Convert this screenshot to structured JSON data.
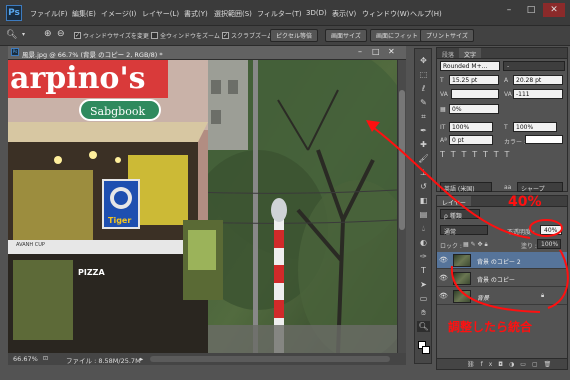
{
  "app": {
    "logo": "Ps"
  },
  "menu": [
    "ファイル(F)",
    "編集(E)",
    "イメージ(I)",
    "レイヤー(L)",
    "書式(Y)",
    "選択範囲(S)",
    "フィルター(T)",
    "3D(D)",
    "表示(V)",
    "ウィンドウ(W)",
    "ヘルプ(H)"
  ],
  "window_controls": {
    "minimize": "–",
    "maximize": "□",
    "close": "✕"
  },
  "options_bar": {
    "tool_icon": "zoom-icon",
    "zoom_in": "⊕",
    "zoom_out": "⊖",
    "resize_windows": "ウィンドウサイズを変更",
    "zoom_all": "全ウィンドウをズーム",
    "scrubby_zoom": "スクラブズーム",
    "actual_pixels": "ピクセル等倍",
    "fit_screen": "画面サイズ",
    "fill_screen": "画面にフィット",
    "print_size": "プリントサイズ"
  },
  "document": {
    "tab_title": "風景.jpg @ 66.7% (背景 のコピー 2, RGB/8) *",
    "zoom": "66.67%",
    "file_info": "ファイル : 8.58M/25.7M",
    "signs": {
      "top": "arpino's",
      "green": "Sabgbook",
      "blue": "Tiger",
      "pizza": "PIZZA",
      "small": "AVANH CUP"
    }
  },
  "character_panel": {
    "tabs": [
      "段落",
      "文字"
    ],
    "font": "Rounded M+...",
    "font_style": "-",
    "font_size": "15.25 pt",
    "leading": "20.28 pt",
    "kerning": "VA",
    "tracking": "-111",
    "tsume": "0%",
    "vscale": "100%",
    "hscale": "100%",
    "baseline": "0 pt",
    "color_label": "カラー :",
    "language": "英語 (米国)",
    "aa_label": "aa",
    "antialias": "シャープ"
  },
  "layers_panel": {
    "tab": "レイヤー",
    "filter_kind": "ρ 種類",
    "blend_mode": "通常",
    "opacity_label": "不透明度 :",
    "opacity": "40%",
    "opacity_fraction": 0.4,
    "lock_label": "ロック :",
    "fill_label": "塗り :",
    "fill": "100%",
    "layers": [
      {
        "name": "背景 のコピー 2",
        "selected": true
      },
      {
        "name": "背景 のコピー",
        "selected": false
      },
      {
        "name": "背景",
        "selected": false,
        "locked": true
      }
    ],
    "footer_icons": [
      "link-icon",
      "fx-icon",
      "mask-icon",
      "adjustment-icon",
      "folder-icon",
      "new-layer-icon",
      "trash-icon"
    ]
  },
  "annotations": {
    "percent": "40%",
    "merge": "調整したら統合"
  },
  "colors": {
    "annotation": "#ff1010",
    "selected_layer": "#56749a",
    "panel": "#535353"
  }
}
